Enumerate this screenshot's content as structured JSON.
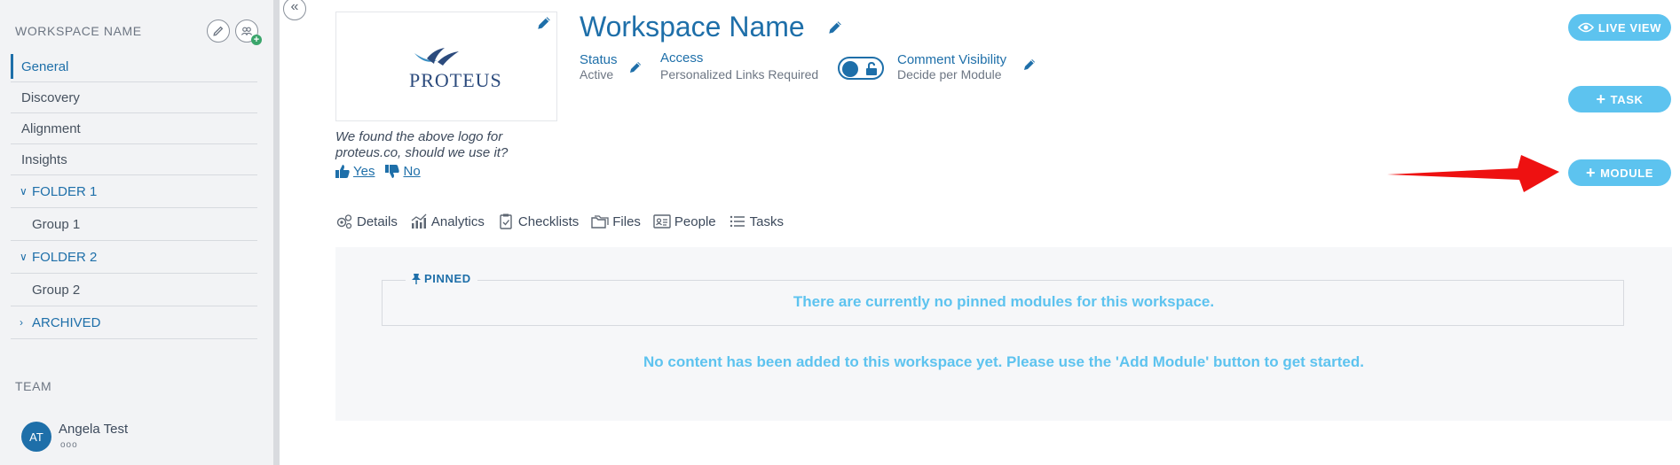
{
  "sidebar": {
    "workspace_header": "WORKSPACE NAME",
    "items": [
      {
        "label": "General"
      },
      {
        "label": "Discovery"
      },
      {
        "label": "Alignment"
      },
      {
        "label": "Insights"
      }
    ],
    "folders": [
      {
        "label": "FOLDER 1",
        "group": "Group 1"
      },
      {
        "label": "FOLDER 2",
        "group": "Group 2"
      }
    ],
    "archived": "ARCHIVED",
    "team_header": "TEAM",
    "member": {
      "initials": "AT",
      "name": "Angela Test",
      "dots": "ooo"
    }
  },
  "collapse_glyph": "«",
  "logo": {
    "text": "PROTEUS",
    "question": "We found the above logo for proteus.co, should we use it?",
    "yes": "Yes",
    "no": "No"
  },
  "header": {
    "title": "Workspace Name",
    "status_label": "Status",
    "status_value": "Active",
    "access_label": "Access",
    "access_value": "Personalized Links Required",
    "comment_label": "Comment Visibility",
    "comment_value": "Decide per Module"
  },
  "buttons": {
    "live_view": "LIVE VIEW",
    "task": "TASK",
    "module": "MODULE"
  },
  "tabs": [
    {
      "label": "Details",
      "icon": "gears-icon"
    },
    {
      "label": "Analytics",
      "icon": "analytics-icon"
    },
    {
      "label": "Checklists",
      "icon": "clipboard-icon"
    },
    {
      "label": "Files",
      "icon": "folders-icon"
    },
    {
      "label": "People",
      "icon": "id-card-icon"
    },
    {
      "label": "Tasks",
      "icon": "list-icon"
    }
  ],
  "content": {
    "pinned_label": "PINNED",
    "no_pinned": "There are currently no pinned modules for this workspace.",
    "no_content": "No content has been added to this workspace yet. Please use the 'Add Module' button to get started."
  },
  "colors": {
    "brand_blue": "#1e6fa9",
    "light_blue": "#5dc3ef",
    "annotation_red": "#ee1111"
  }
}
